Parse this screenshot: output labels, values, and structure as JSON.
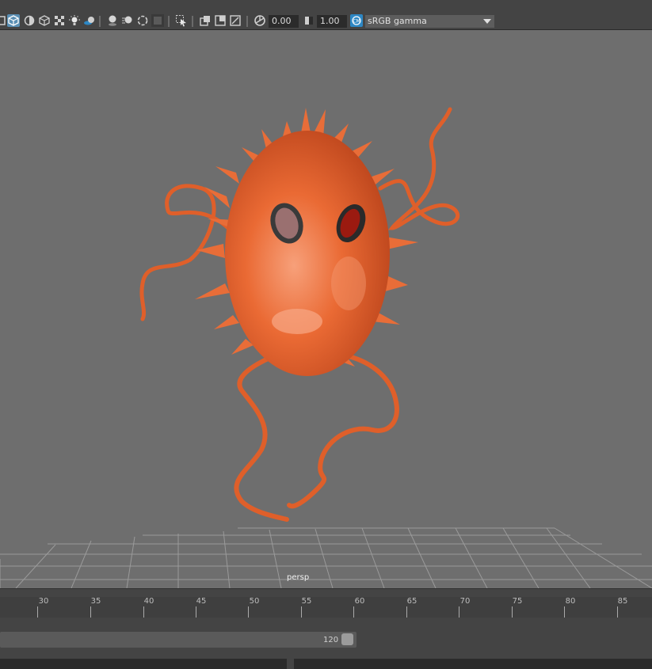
{
  "toolbar": {
    "icons": [
      "wireframe-shaded-icon",
      "default-material-icon",
      "xray-icon",
      "xray-joints-icon",
      "lights-icon",
      "shadows-icon",
      "ambient-occlusion-icon",
      "motion-blur-icon",
      "multisample-aa-icon",
      "depth-of-field-icon",
      "isolate-select-icon",
      "camera-gate-icon",
      "grid-icon",
      "resolution-gate-icon",
      "exposure-icon",
      "gamma-icon",
      "color-management-icon"
    ],
    "exposure_value": "0.00",
    "gamma_value": "1.00",
    "color_space": "sRGB gamma"
  },
  "viewport": {
    "camera_label": "persp",
    "background_color": "#6e6e6e",
    "grid_color": "#9a9a9a",
    "model_color": "#e2622a"
  },
  "timeslider": {
    "tick_labels": [
      "30",
      "35",
      "40",
      "45",
      "50",
      "55",
      "60",
      "65",
      "70",
      "75",
      "80",
      "85"
    ]
  },
  "range_slider": {
    "end_label": "120"
  }
}
